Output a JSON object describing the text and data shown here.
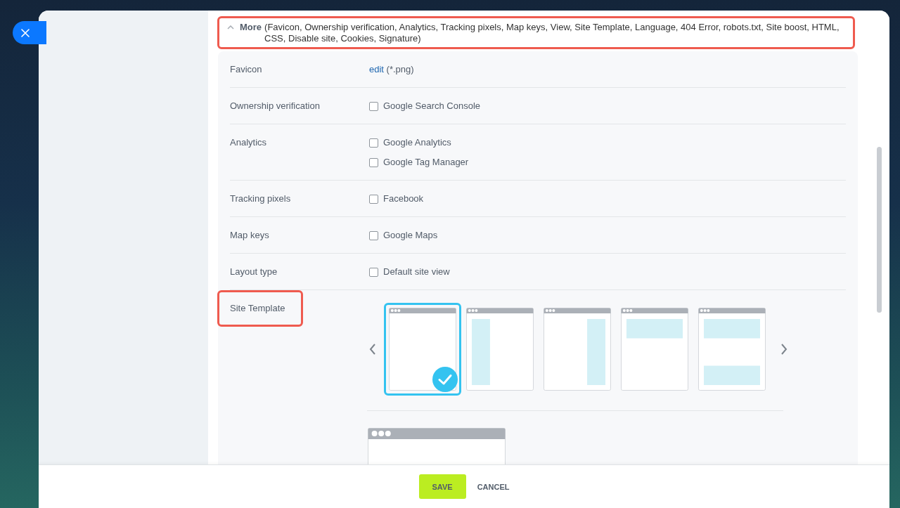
{
  "more_section": {
    "title": "More",
    "summary": "(Favicon,  Ownership verification,  Analytics,  Tracking pixels,  Map keys,  View,  Site Template,  Language,  404 Error,  robots.txt,  Site boost,  HTML,  CSS,  Disable site,  Cookies,  Signature)",
    "expanded": true,
    "highlighted": true
  },
  "rows": [
    {
      "kind": "link",
      "label": "Favicon",
      "link": "edit",
      "note": "(*.png)"
    },
    {
      "kind": "checkboxes",
      "label": "Ownership verification",
      "options": [
        {
          "label": "Google Search Console",
          "checked": false
        }
      ]
    },
    {
      "kind": "checkboxes",
      "label": "Analytics",
      "options": [
        {
          "label": "Google Analytics",
          "checked": false
        },
        {
          "label": "Google Tag Manager",
          "checked": false
        }
      ]
    },
    {
      "kind": "checkboxes",
      "label": "Tracking pixels",
      "options": [
        {
          "label": "Facebook",
          "checked": false
        }
      ]
    },
    {
      "kind": "checkboxes",
      "label": "Map keys",
      "options": [
        {
          "label": "Google Maps",
          "checked": false
        }
      ]
    },
    {
      "kind": "checkboxes",
      "label": "Layout type",
      "options": [
        {
          "label": "Default site view",
          "checked": false
        }
      ]
    },
    {
      "kind": "templates",
      "label": "Site Template",
      "highlighted": true,
      "templates": [
        {
          "kind": "blank",
          "selected": true
        },
        {
          "kind": "left",
          "selected": false
        },
        {
          "kind": "right",
          "selected": false
        },
        {
          "kind": "top",
          "selected": false
        },
        {
          "kind": "split",
          "selected": false
        }
      ]
    }
  ],
  "footer": {
    "buttons": [
      {
        "label": "SAVE",
        "kind": "primary"
      },
      {
        "label": "CANCEL",
        "kind": "link"
      }
    ]
  }
}
